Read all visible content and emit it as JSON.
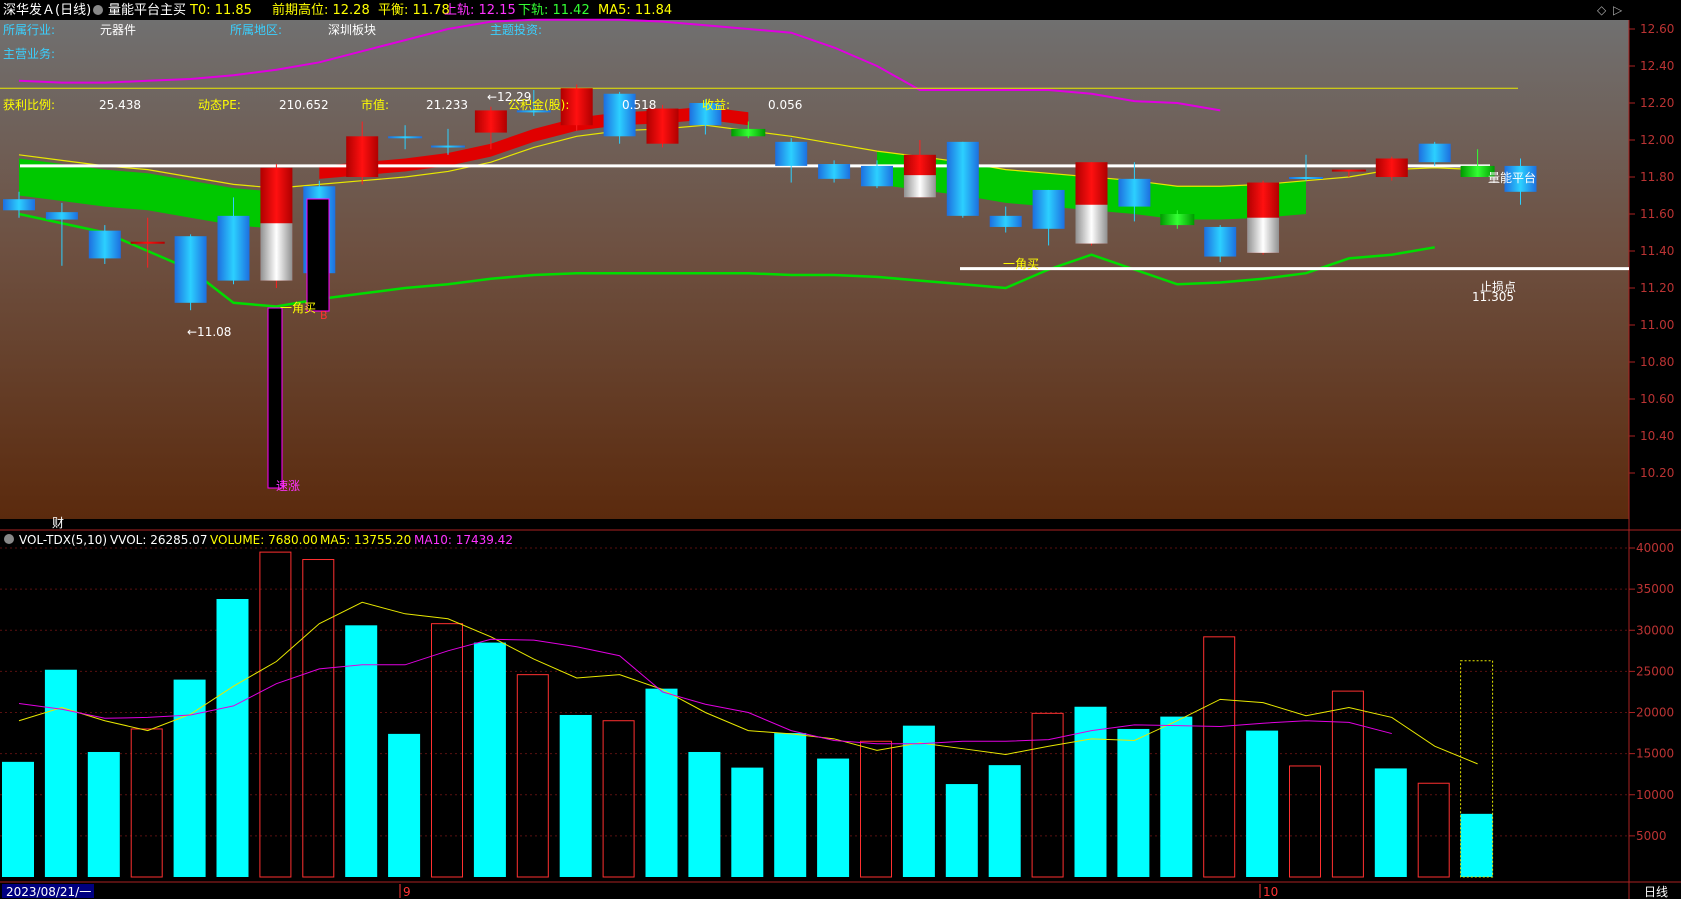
{
  "header": {
    "stock": "深华发Ａ(日线)",
    "indicator": "量能平台主买",
    "t0": "T0: 11.85",
    "prev_high": "前期高位: 12.28",
    "balance": "平衡: 11.78",
    "upper": "上轨: 12.15",
    "lower": "下轨: 11.42",
    "ma5": "MA5: 11.84"
  },
  "info": {
    "row1": [
      "所属行业:",
      "元器件",
      "所属地区:",
      "深圳板块",
      "主题投资:"
    ],
    "row2": [
      "主营业务:"
    ],
    "row3": [
      "获利比例:",
      "25.438",
      "动态PE:",
      "210.652",
      "市值:",
      "21.233",
      "公积金(股):",
      "0.518",
      "收益:",
      "0.056"
    ]
  },
  "annotations": {
    "high_mark": "←12.29",
    "low_mark": "←11.08",
    "buy1": "一角买",
    "buy2": "一角买",
    "surge": "速涨",
    "platform": "量能平台",
    "stop": "止损点",
    "stop_val": "11.305",
    "cai": "财",
    "b_marker": "B"
  },
  "price_axis": [
    "12.60",
    "12.40",
    "12.20",
    "12.00",
    "11.80",
    "11.60",
    "11.40",
    "11.20",
    "11.00",
    "10.80",
    "10.60",
    "10.40",
    "10.20"
  ],
  "vol_header": {
    "name": "VOL-TDX(5,10)",
    "vvol": "VVOL: 26285.07",
    "volume": "VOLUME: 7680.00",
    "ma5": "MA5: 13755.20",
    "ma10": "MA10: 17439.42"
  },
  "vol_axis": [
    "40000",
    "35000",
    "30000",
    "25000",
    "20000",
    "15000",
    "10000",
    "5000"
  ],
  "footer": {
    "date": "2023/08/21/一",
    "month9": "9",
    "month10": "10",
    "period": "日线"
  },
  "colors": {
    "up": "#e00000",
    "down": "#1aa0ff",
    "vol_down": "#00ffff",
    "vol_up": "#ff3030",
    "ma_yellow": "#ffff00",
    "ma_magenta": "#ff00ff",
    "green_band": "#00cc00"
  },
  "chart_data": {
    "type": "candlestick",
    "price_range": [
      10.12,
      12.72
    ],
    "volume_range": [
      0,
      41000
    ],
    "candles": [
      {
        "o": 11.62,
        "c": 11.68,
        "h": 11.72,
        "l": 11.58,
        "dir": "down"
      },
      {
        "o": 11.61,
        "c": 11.57,
        "h": 11.66,
        "l": 11.32,
        "dir": "down"
      },
      {
        "o": 11.51,
        "c": 11.36,
        "h": 11.54,
        "l": 11.33,
        "dir": "down"
      },
      {
        "o": 11.45,
        "c": 11.44,
        "h": 11.58,
        "l": 11.31,
        "dir": "up"
      },
      {
        "o": 11.48,
        "c": 11.12,
        "h": 11.49,
        "l": 11.08,
        "dir": "down"
      },
      {
        "o": 11.59,
        "c": 11.24,
        "h": 11.69,
        "l": 11.22,
        "dir": "down"
      },
      {
        "o": 11.24,
        "c": 11.85,
        "h": 11.87,
        "l": 11.2,
        "dir": "up"
      },
      {
        "o": 11.75,
        "c": 11.28,
        "h": 11.78,
        "l": 11.12,
        "dir": "down"
      },
      {
        "o": 11.8,
        "c": 12.02,
        "h": 12.1,
        "l": 11.76,
        "dir": "up"
      },
      {
        "o": 12.02,
        "c": 12.01,
        "h": 12.08,
        "l": 11.95,
        "dir": "down"
      },
      {
        "o": 11.97,
        "c": 11.97,
        "h": 12.06,
        "l": 11.92,
        "dir": "down"
      },
      {
        "o": 12.04,
        "c": 12.16,
        "h": 12.18,
        "l": 11.95,
        "dir": "up"
      },
      {
        "o": 12.16,
        "c": 12.16,
        "h": 12.27,
        "l": 12.13,
        "dir": "down"
      },
      {
        "o": 12.08,
        "c": 12.28,
        "h": 12.3,
        "l": 12.05,
        "dir": "up"
      },
      {
        "o": 12.25,
        "c": 12.02,
        "h": 12.26,
        "l": 11.98,
        "dir": "down"
      },
      {
        "o": 11.98,
        "c": 12.17,
        "h": 12.19,
        "l": 11.96,
        "dir": "up"
      },
      {
        "o": 12.2,
        "c": 12.08,
        "h": 12.22,
        "l": 12.03,
        "dir": "down"
      },
      {
        "o": 12.02,
        "c": 12.06,
        "h": 12.1,
        "l": 12.01,
        "dir": "green"
      },
      {
        "o": 11.99,
        "c": 11.86,
        "h": 12.01,
        "l": 11.77,
        "dir": "down"
      },
      {
        "o": 11.87,
        "c": 11.79,
        "h": 11.89,
        "l": 11.77,
        "dir": "down"
      },
      {
        "o": 11.86,
        "c": 11.75,
        "h": 11.89,
        "l": 11.74,
        "dir": "down"
      },
      {
        "o": 11.69,
        "c": 11.92,
        "h": 12.0,
        "l": 11.69,
        "dir": "up"
      },
      {
        "o": 11.99,
        "c": 11.59,
        "h": 11.99,
        "l": 11.58,
        "dir": "down"
      },
      {
        "o": 11.59,
        "c": 11.53,
        "h": 11.64,
        "l": 11.5,
        "dir": "down"
      },
      {
        "o": 11.73,
        "c": 11.52,
        "h": 11.73,
        "l": 11.43,
        "dir": "down"
      },
      {
        "o": 11.44,
        "c": 11.88,
        "h": 11.88,
        "l": 11.43,
        "dir": "up"
      },
      {
        "o": 11.79,
        "c": 11.64,
        "h": 11.88,
        "l": 11.56,
        "dir": "down"
      },
      {
        "o": 11.6,
        "c": 11.54,
        "h": 11.62,
        "l": 11.52,
        "dir": "green"
      },
      {
        "o": 11.53,
        "c": 11.37,
        "h": 11.54,
        "l": 11.34,
        "dir": "down"
      },
      {
        "o": 11.39,
        "c": 11.77,
        "h": 11.78,
        "l": 11.38,
        "dir": "up"
      },
      {
        "o": 11.8,
        "c": 11.8,
        "h": 11.92,
        "l": 11.78,
        "dir": "down"
      },
      {
        "o": 11.84,
        "c": 11.84,
        "h": 11.84,
        "l": 11.8,
        "dir": "up"
      },
      {
        "o": 11.8,
        "c": 11.9,
        "h": 11.91,
        "l": 11.78,
        "dir": "up"
      },
      {
        "o": 11.98,
        "c": 11.88,
        "h": 11.99,
        "l": 11.86,
        "dir": "down"
      },
      {
        "o": 11.8,
        "c": 11.86,
        "h": 11.95,
        "l": 11.8,
        "dir": "green"
      },
      {
        "o": 11.86,
        "c": 11.72,
        "h": 11.9,
        "l": 11.65,
        "dir": "down"
      }
    ],
    "volume": {
      "values": [
        14000,
        25200,
        15200,
        18000,
        24000,
        33800,
        39500,
        38600,
        30600,
        17400,
        30800,
        28500,
        24600,
        19700,
        19000,
        22900,
        15200,
        13300,
        17500,
        14400,
        16500,
        18400,
        11300,
        13600,
        19900,
        20700,
        18000,
        19500,
        29200,
        17800,
        13500,
        22600,
        13200,
        11400,
        7680
      ],
      "dir": [
        "d",
        "d",
        "d",
        "u",
        "d",
        "d",
        "u",
        "u",
        "d",
        "d",
        "u",
        "d",
        "u",
        "d",
        "u",
        "d",
        "d",
        "d",
        "d",
        "d",
        "u",
        "d",
        "d",
        "d",
        "u",
        "d",
        "d",
        "d",
        "u",
        "d",
        "u",
        "u",
        "d",
        "u",
        "d"
      ],
      "ma5": [
        19000,
        20600,
        19000,
        17800,
        19800,
        23200,
        26200,
        30800,
        33400,
        32000,
        31400,
        29200,
        26500,
        24200,
        24600,
        22800,
        20000,
        17800,
        17400,
        16800,
        15400,
        16300,
        15600,
        14900,
        15900,
        16800,
        16600,
        19000,
        21600,
        21200,
        19600,
        20600,
        19400,
        15900,
        13755
      ],
      "ma10": [
        21100,
        20400,
        19300,
        19400,
        19700,
        20800,
        23500,
        25300,
        25800,
        25800,
        27500,
        28900,
        28800,
        28000,
        26900,
        22500,
        21000,
        20000,
        17800,
        16600,
        16200,
        16200,
        16500,
        16500,
        16700,
        17800,
        18500,
        18400,
        18300,
        18700,
        19000,
        18800,
        17439
      ]
    },
    "overlays": {
      "yellow_ma": [
        11.92,
        11.89,
        11.86,
        11.84,
        11.8,
        11.76,
        11.74,
        11.76,
        11.78,
        11.8,
        11.83,
        11.88,
        11.96,
        12.02,
        12.05,
        12.06,
        12.08,
        12.05,
        12.02,
        11.98,
        11.94,
        11.91,
        11.88,
        11.84,
        11.82,
        11.8,
        11.78,
        11.75,
        11.75,
        11.76,
        11.78,
        11.8,
        11.84,
        11.85,
        11.84
      ],
      "magenta_upper": [
        12.32,
        12.31,
        12.31,
        12.32,
        12.33,
        12.35,
        12.38,
        12.42,
        12.48,
        12.54,
        12.6,
        12.64,
        12.65,
        12.65,
        12.65,
        12.64,
        12.62,
        12.6,
        12.58,
        12.5,
        12.4,
        12.27,
        12.27,
        12.27,
        12.27,
        12.25,
        12.21,
        12.2,
        12.16
      ],
      "green_lower": [
        11.6,
        11.55,
        11.5,
        11.4,
        11.3,
        11.12,
        11.1,
        11.14,
        11.17,
        11.2,
        11.22,
        11.25,
        11.27,
        11.28,
        11.28,
        11.28,
        11.28,
        11.28,
        11.27,
        11.27,
        11.26,
        11.24,
        11.22,
        11.2,
        11.3,
        11.38,
        11.3,
        11.22,
        11.23,
        11.25,
        11.28,
        11.36,
        11.38,
        11.42
      ],
      "white_platform": 11.86,
      "white_stop": 11.305,
      "yellow_hline": 12.28
    }
  }
}
